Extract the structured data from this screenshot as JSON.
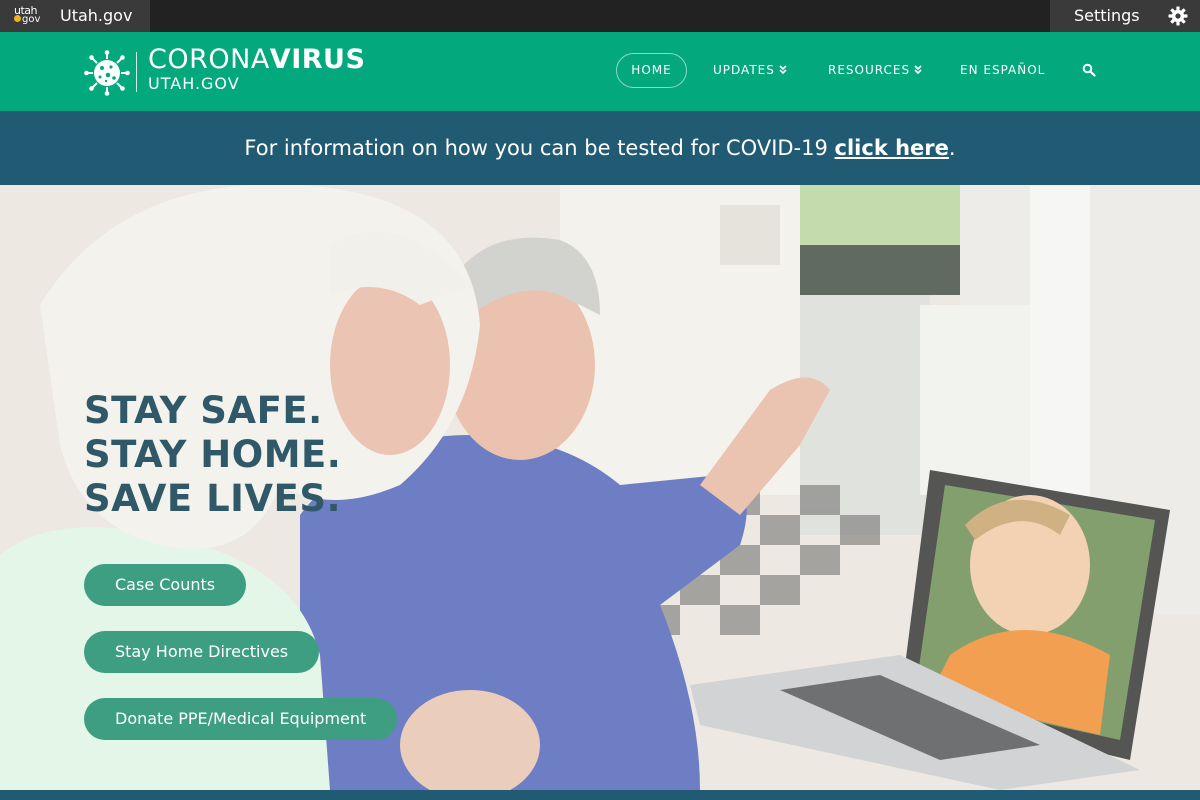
{
  "topbar": {
    "logo_line1": "utah",
    "logo_line2": "gov",
    "title": "Utah.gov",
    "settings_label": "Settings"
  },
  "header": {
    "logo_main_light": "CORONA",
    "logo_main_bold": "VIRUS",
    "logo_sub": "UTAH.GOV",
    "nav": {
      "home": "HOME",
      "updates": "UPDATES",
      "resources": "RESOURCES",
      "espanol": "EN ESPAÑOL"
    }
  },
  "banner": {
    "text": "For information on how you can be tested for COVID-19 ",
    "link": "click here",
    "suffix": "."
  },
  "hero": {
    "headline": [
      "STAY SAFE.",
      "STAY HOME.",
      "SAVE LIVES."
    ],
    "buttons": [
      "Case Counts",
      "Stay Home Directives",
      "Donate PPE/Medical Equipment"
    ]
  },
  "colors": {
    "header_green": "#03a87d",
    "banner_teal": "#215a73",
    "button_green": "#3d9e82",
    "headline_blue": "#2f5968",
    "topbar_dark": "#222222"
  },
  "icons": [
    "virus-icon",
    "gear-icon",
    "chevron-double-down-icon",
    "search-icon"
  ]
}
